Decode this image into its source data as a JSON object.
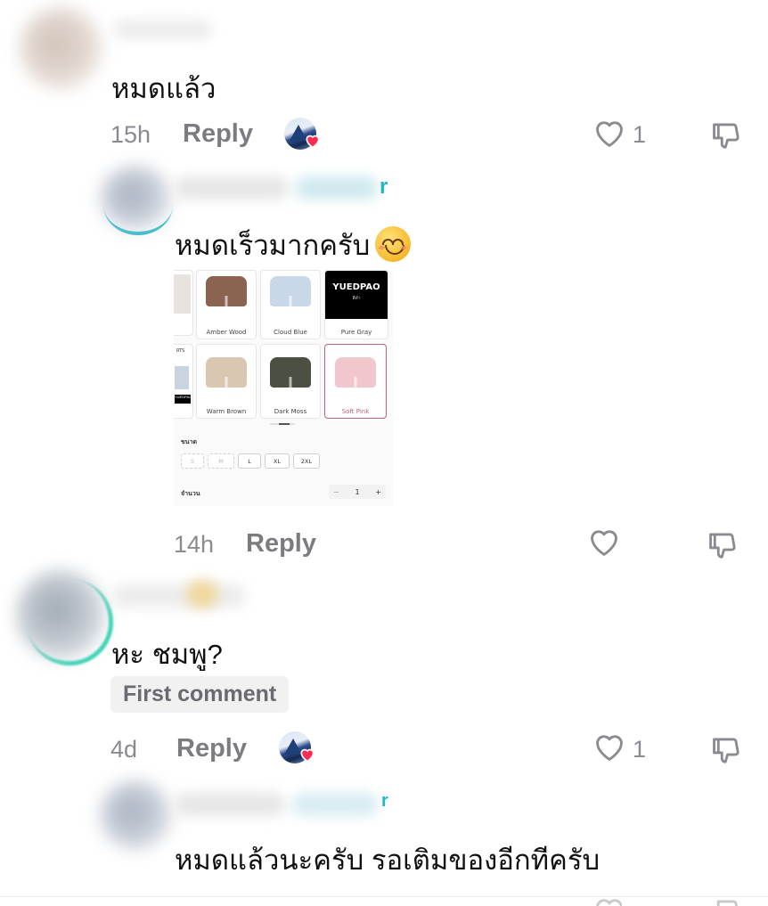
{
  "comments": [
    {
      "text": "หมดแล้ว",
      "time": "15h",
      "reply_label": "Reply",
      "like_count": "1"
    },
    {
      "text": "หมดเร็วมากครับ",
      "time": "14h",
      "reply_label": "Reply",
      "name_suffix": "r",
      "product": {
        "colors": [
          {
            "label": "Amber Wood",
            "hex": "#8a6450"
          },
          {
            "label": "Cloud Blue",
            "hex": "#c9d8e8"
          },
          {
            "label": "Pure Gray",
            "hex": "#000000"
          },
          {
            "label": "Warm Brown",
            "hex": "#d9c7b1"
          },
          {
            "label": "Dark Moss",
            "hex": "#4b5043"
          },
          {
            "label": "Soft Pink",
            "hex": "#f1c6cc"
          }
        ],
        "brand": "YUEDPAO",
        "brand_sub": "สีดำ",
        "side_text_top": "RTS",
        "side_text_bottom": "YUEDPAO",
        "size_label": "ขนาด",
        "sizes": [
          "S",
          "M",
          "L",
          "XL",
          "2XL"
        ],
        "quantity_label": "จำนวน",
        "quantity_minus": "−",
        "quantity": "1",
        "quantity_plus": "+"
      }
    },
    {
      "text": "หะ ชมพู?",
      "badge": "First comment",
      "time": "4d",
      "reply_label": "Reply",
      "like_count": "1"
    },
    {
      "text": "หมดแล้วนะครับ รอเติมของอีกทีครับ",
      "name_suffix": "r"
    }
  ],
  "colors": {
    "accent_teal": "#1fb8c7",
    "liked_heart": "#fe2c55",
    "icon_gray": "#8a8b91"
  }
}
